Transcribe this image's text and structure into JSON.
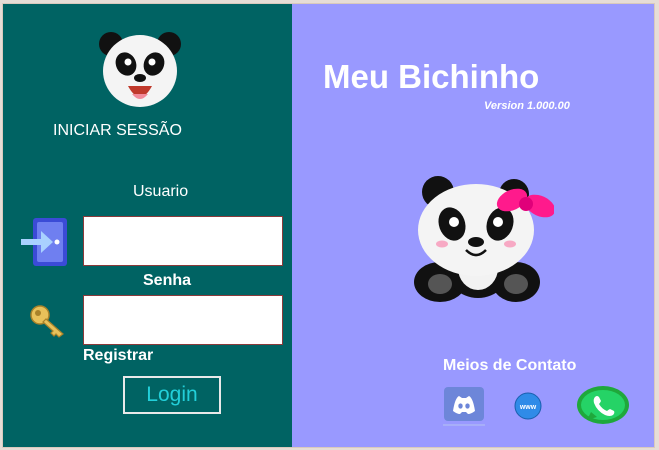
{
  "login_panel": {
    "heading": "INICIAR SESSÃO",
    "usuario_label": "Usuario",
    "usuario_value": "",
    "senha_label": "Senha",
    "senha_value": "",
    "registrar_link": "Registrar",
    "login_button": "Login",
    "icons": [
      "panda-face-icon",
      "door-enter-icon",
      "key-icon"
    ]
  },
  "brand_panel": {
    "app_title": "Meu Bichinho",
    "version": "Version 1.000.00",
    "contact_heading": "Meios de Contato",
    "icons": [
      "panda-bow-icon",
      "discord-icon",
      "www-icon",
      "whatsapp-icon"
    ]
  },
  "colors": {
    "left_panel_bg": "#006363",
    "right_panel_bg": "#9999ff",
    "login_button_text": "#22cfd9",
    "bow": "#ff1a8c"
  }
}
